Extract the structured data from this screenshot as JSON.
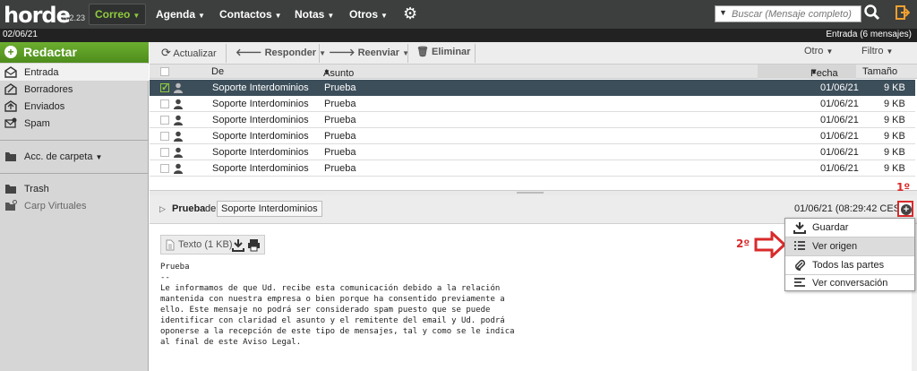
{
  "app": {
    "logo": "horde",
    "version": "5.2.23"
  },
  "nav": {
    "items": [
      {
        "label": "Correo",
        "active": true
      },
      {
        "label": "Agenda"
      },
      {
        "label": "Contactos"
      },
      {
        "label": "Notas"
      },
      {
        "label": "Otros"
      }
    ],
    "caret": "▼",
    "gear_icon": "gear-icon"
  },
  "search": {
    "placeholder": "Buscar (Mensaje completo)",
    "value": ""
  },
  "status": {
    "date": "02/06/21",
    "mailbox": "Entrada (6 mensajes)"
  },
  "sidebar": {
    "compose_label": "Redactar",
    "folders": [
      {
        "label": "Entrada",
        "icon": "inbox-icon",
        "selected": true
      },
      {
        "label": "Borradores",
        "icon": "drafts-icon"
      },
      {
        "label": "Enviados",
        "icon": "sent-icon"
      },
      {
        "label": "Spam",
        "icon": "spam-icon"
      }
    ],
    "folder_actions": "Acc. de carpeta",
    "extra_folders": [
      {
        "label": "Trash",
        "icon": "folder-icon"
      },
      {
        "label": "Carp Virtuales",
        "icon": "virtual-folder-icon"
      }
    ]
  },
  "toolbar": {
    "refresh": "Actualizar",
    "reply": "Responder",
    "forward": "Reenviar",
    "delete": "Eliminar",
    "other": "Otro",
    "filter": "Filtro"
  },
  "list": {
    "columns": {
      "from": "De",
      "subject": "Asunto",
      "date": "Fecha",
      "size": "Tamaño"
    },
    "rows": [
      {
        "from": "Soporte Interdominios",
        "subject": "Prueba",
        "date": "01/06/21",
        "size": "9 KB",
        "selected": true
      },
      {
        "from": "Soporte Interdominios",
        "subject": "Prueba",
        "date": "01/06/21",
        "size": "9 KB"
      },
      {
        "from": "Soporte Interdominios",
        "subject": "Prueba",
        "date": "01/06/21",
        "size": "9 KB"
      },
      {
        "from": "Soporte Interdominios",
        "subject": "Prueba",
        "date": "01/06/21",
        "size": "9 KB"
      },
      {
        "from": "Soporte Interdominios",
        "subject": "Prueba",
        "date": "01/06/21",
        "size": "9 KB"
      },
      {
        "from": "Soporte Interdominios",
        "subject": "Prueba",
        "date": "01/06/21",
        "size": "9 KB"
      }
    ]
  },
  "preview": {
    "subject": "Prueba",
    "from_prefix": "de",
    "from": "Soporte Interdominios",
    "datetime": "01/06/21 (08:29:42 CEST)",
    "attachment": "Texto (1 KB)",
    "body_lines": [
      "Prueba",
      "",
      "",
      "--",
      "",
      "Le informamos de que Ud. recibe esta comunicación debido a la relación",
      "mantenida con nuestra empresa o bien porque ha consentido previamente a",
      "ello. Este mensaje no podrá ser considerado spam puesto que se puede",
      "identificar con claridad el asunto y el remitente del email y Ud. podrá",
      "oponerse a la recepción de este tipo de mensajes, tal y como se le indica",
      "al final de este Aviso Legal."
    ]
  },
  "annotations": {
    "step1": "1º",
    "step2": "2º",
    "accent": "#d92a2a"
  },
  "menu": {
    "items": [
      {
        "label": "Guardar",
        "icon": "download-icon"
      },
      {
        "label": "Ver origen",
        "icon": "list-icon",
        "highlighted": true
      },
      {
        "label": "Todos las partes",
        "icon": "paperclip-icon"
      },
      {
        "label": "Ver conversación",
        "icon": "align-left-icon"
      }
    ]
  },
  "colors": {
    "brand_green": "#6cae2f",
    "topbar": "#3d3f3e",
    "selected_row": "#3c4e5a"
  }
}
